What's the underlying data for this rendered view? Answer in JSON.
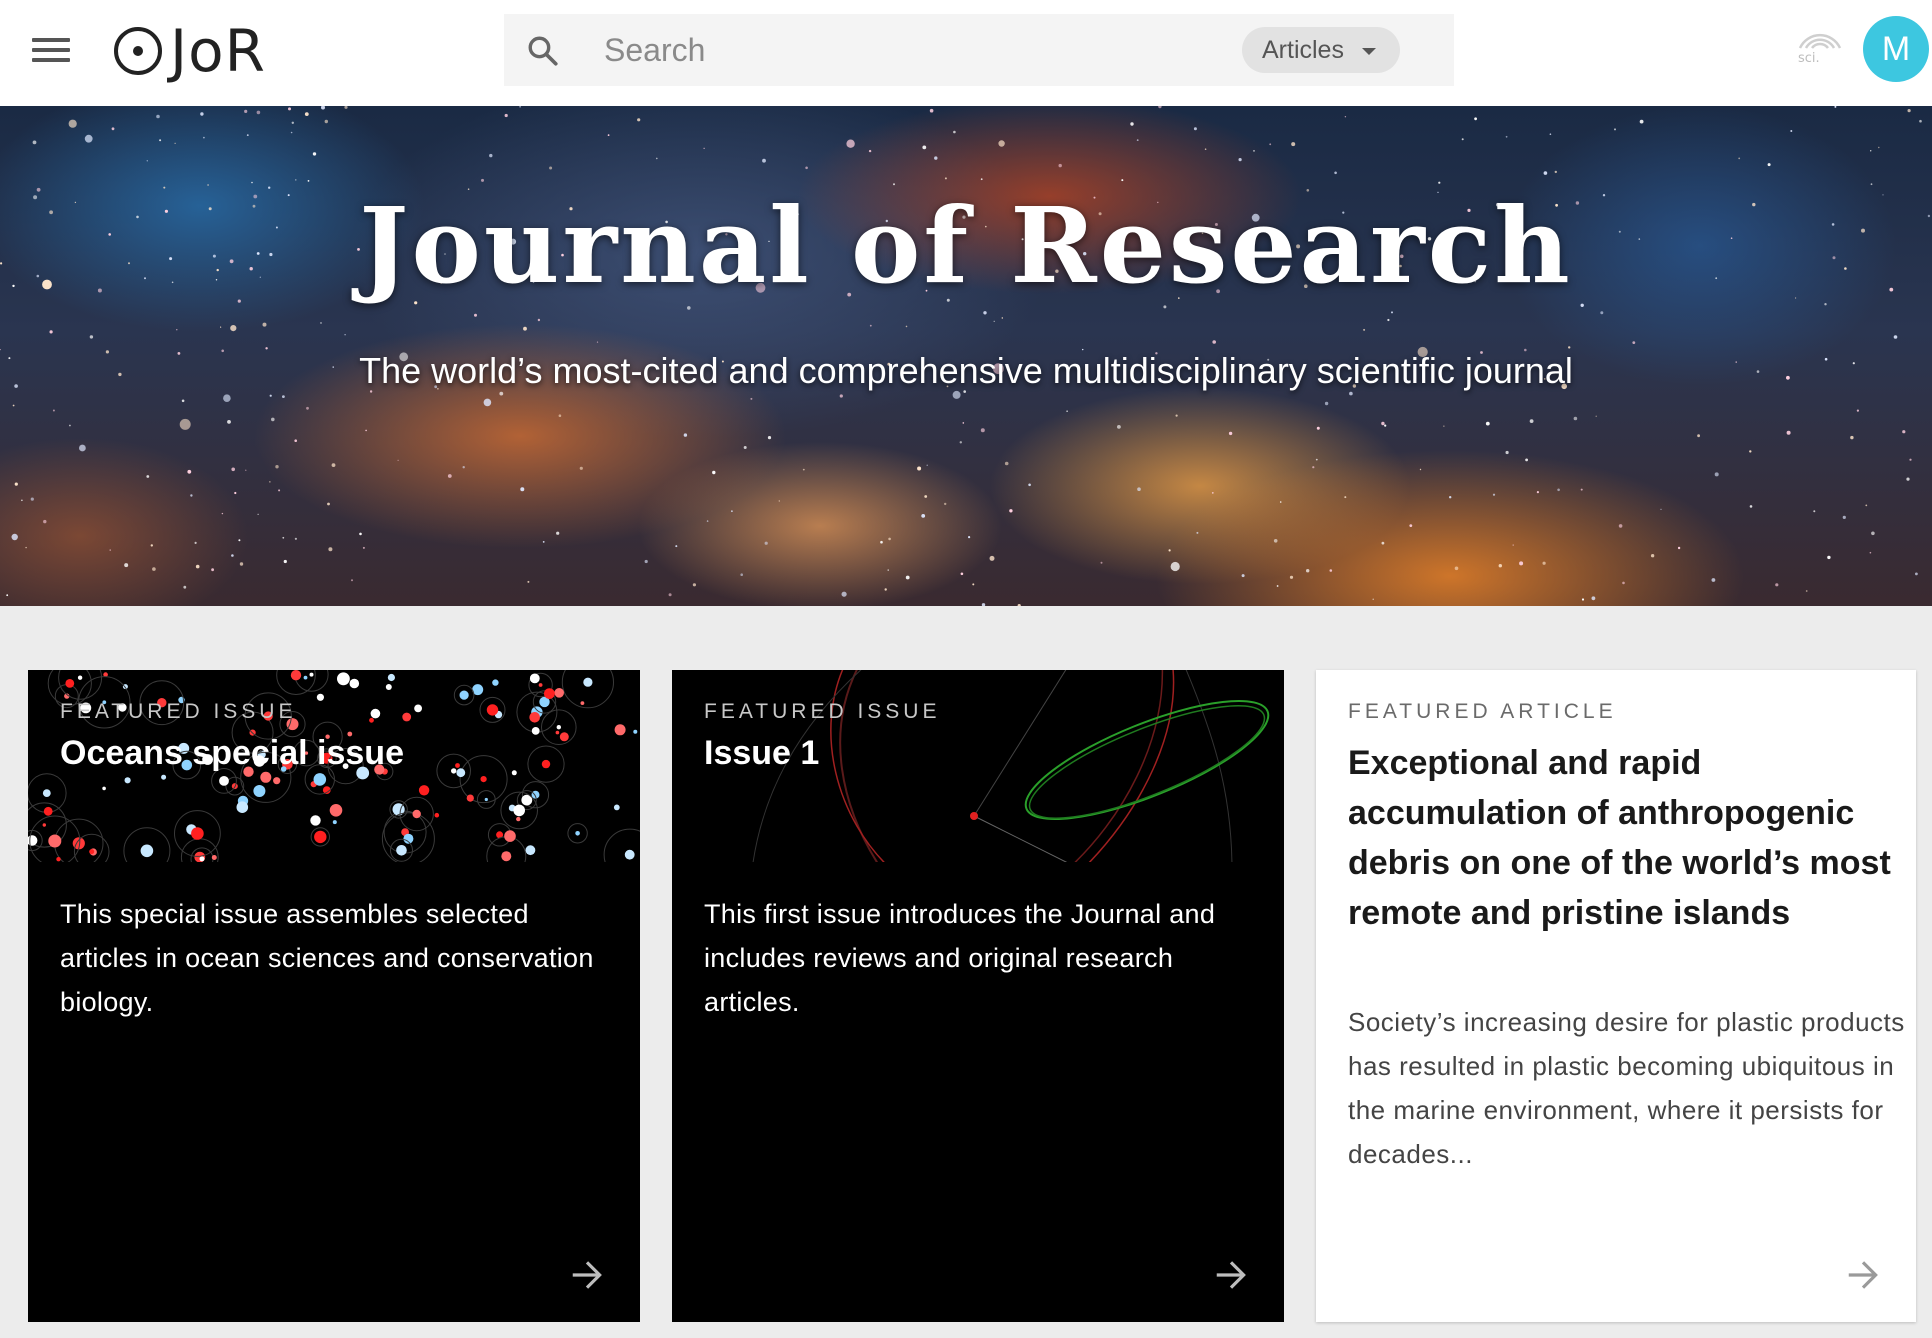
{
  "header": {
    "logo_text": "JoR",
    "search": {
      "placeholder": "Search",
      "value": ""
    },
    "scope": {
      "label": "Articles"
    },
    "sci_icon_label": "sci.",
    "avatar_initial": "M"
  },
  "hero": {
    "title": "Journal of Research",
    "subtitle": "The world’s most-cited and comprehensive multidisciplinary scientific journal"
  },
  "cards": [
    {
      "kicker": "FEATURED ISSUE",
      "title": "Oceans special issue",
      "description": "This special issue assembles selected articles in ocean sciences and conservation biology."
    },
    {
      "kicker": "FEATURED ISSUE",
      "title": "Issue 1",
      "description": "This first issue introduces the Journal and includes reviews and original research articles."
    },
    {
      "kicker": "FEATURED ARTICLE",
      "title": "Exceptional and rapid accumulation of anthropogenic debris on one of the world’s most remote and pristine islands",
      "description": "Society’s increasing desire for plastic products has resulted in plastic becoming ubiquitous in the marine environment, where it persists for decades..."
    }
  ],
  "colors": {
    "avatar": "#3dc7e0",
    "topbar": "#ffffff",
    "page_bg": "#ececec",
    "card_dark": "#000000"
  },
  "icons": {
    "menu": "menu-icon",
    "search": "search-icon",
    "scope_caret": "chevron-down-icon",
    "sci": "sci-signal-icon",
    "card_arrow": "arrow-right-icon"
  }
}
